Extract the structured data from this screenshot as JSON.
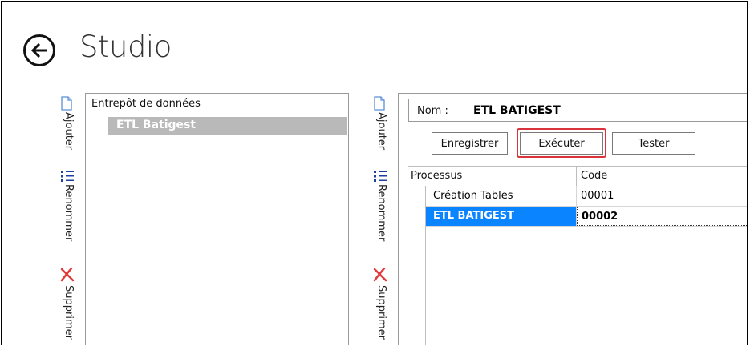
{
  "header": {
    "title": "Studio",
    "back_icon": "arrow-left-icon"
  },
  "toolbar": {
    "add_label": "Ajouter",
    "rename_label": "Renommer",
    "delete_label": "Supprimer",
    "icons": {
      "add": "document-icon",
      "rename": "list-icon",
      "delete": "delete-x-icon"
    }
  },
  "left_panel": {
    "header": "Entrepôt de données",
    "items": [
      {
        "label": "ETL Batigest",
        "selected": true
      }
    ]
  },
  "right_panel": {
    "name_label": "Nom :",
    "name_value": "ETL BATIGEST",
    "buttons": {
      "save": "Enregistrer",
      "execute": "Exécuter",
      "test": "Tester"
    },
    "grid": {
      "columns": [
        "Processus",
        "Code"
      ],
      "rows": [
        {
          "process": "Création Tables",
          "code": "00001",
          "selected": false
        },
        {
          "process": "ETL BATIGEST",
          "code": "00002",
          "selected": true
        }
      ]
    }
  },
  "colors": {
    "selection_blue": "#0a84ff",
    "tree_selected": "#b9b9b9",
    "focus_red": "#d9343c",
    "icon_blue": "#1f3fa0",
    "delete_red": "#e23b3b"
  }
}
